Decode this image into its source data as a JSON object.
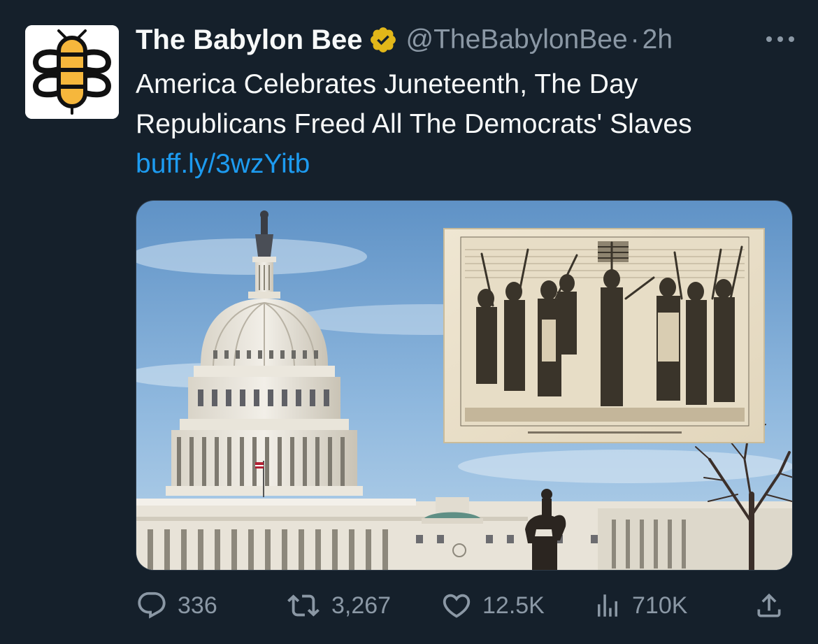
{
  "tweet": {
    "author": {
      "display_name": "The Babylon Bee",
      "handle": "@TheBabylonBee",
      "verified_icon": "verified-badge-icon",
      "avatar_icon": "babylon-bee-logo"
    },
    "separator": "·",
    "time": "2h",
    "more_icon": "more-icon",
    "text_lines": [
      "America Celebrates Juneteenth, The Day",
      "Republicans Freed All The Democrats' Slaves"
    ],
    "link": "buff.ly/3wzYitb",
    "media": {
      "subjects": [
        "us-capitol-dome",
        "historical-engraving",
        "equestrian-statue",
        "bare-tree"
      ]
    },
    "actions": {
      "reply": {
        "icon": "reply-icon",
        "count": "336"
      },
      "retweet": {
        "icon": "retweet-icon",
        "count": "3,267"
      },
      "like": {
        "icon": "heart-icon",
        "count": "12.5K"
      },
      "views": {
        "icon": "views-icon",
        "count": "710K"
      },
      "share": {
        "icon": "share-icon"
      }
    }
  },
  "colors": {
    "background": "#15202b",
    "text_primary": "#f7f9f9",
    "text_secondary": "#8b98a5",
    "link": "#1d9bf0",
    "verified_gold": "#e2b719",
    "bee_yellow": "#f6b73c"
  }
}
